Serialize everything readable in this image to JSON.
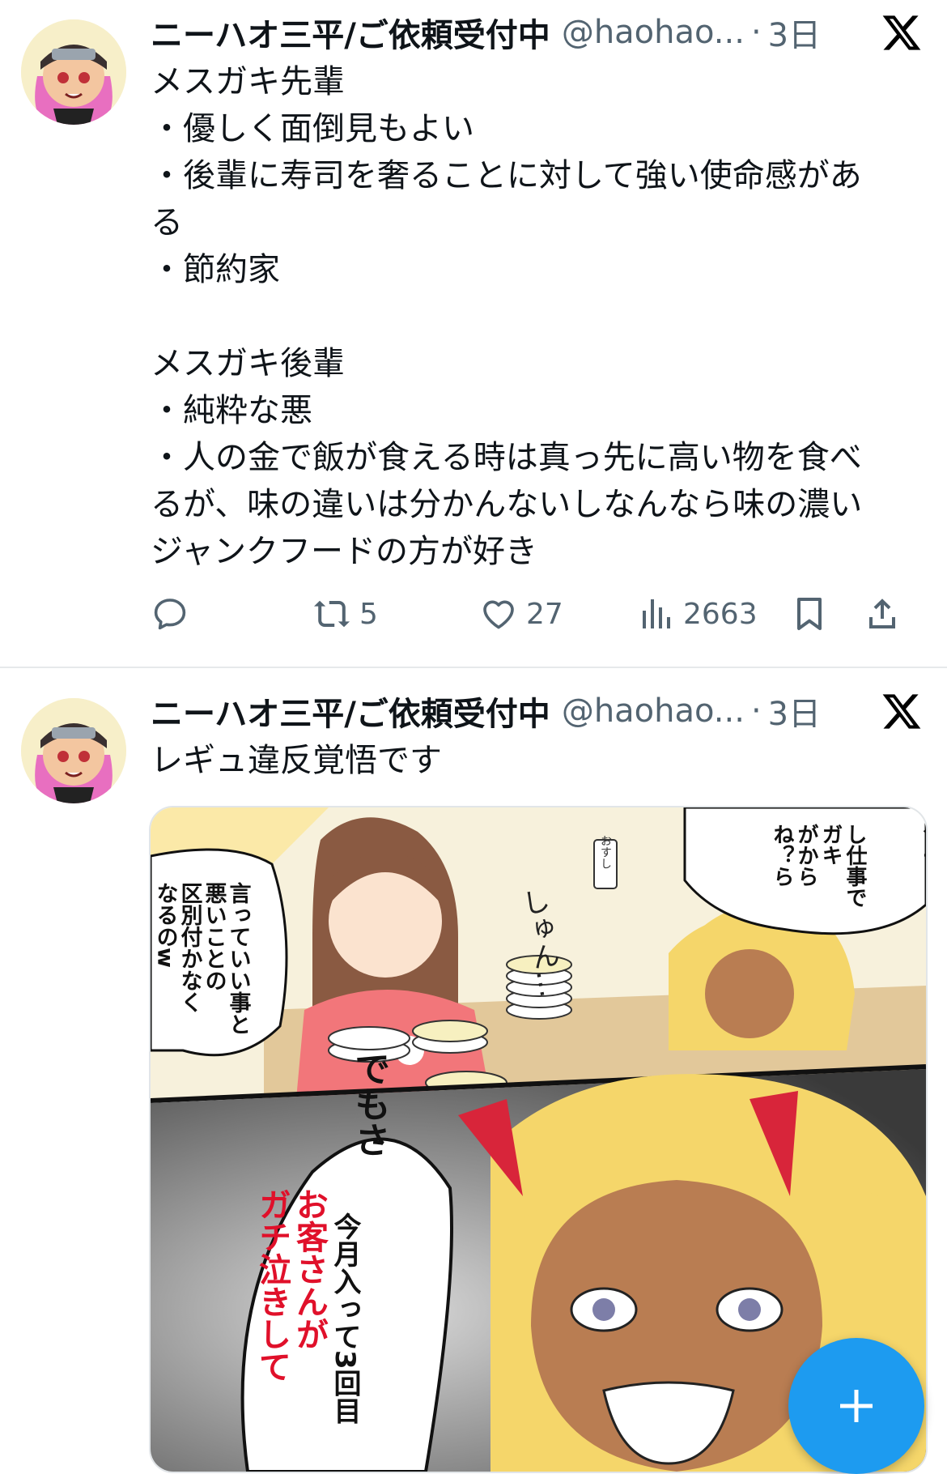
{
  "tweets": [
    {
      "author_name": "ニーハオ三平/ご依頼受付中",
      "handle": "@haohao...",
      "separator": "·",
      "time": "3日",
      "text_lines": [
        "メスガキ先輩",
        "・優しく面倒見もよい",
        "・後輩に寿司を奢ることに対して強い使命感があ",
        "る",
        "・節約家",
        "",
        "メスガキ後輩",
        "・純粋な悪",
        "・人の金で飯が食える時は真っ先に高い物を食べ",
        "るが、味の違いは分かんないしなんなら味の濃い",
        "ジャンクフードの方が好き"
      ],
      "actions": {
        "reply_icon": "reply-icon",
        "retweet_icon": "retweet-icon",
        "retweet_count": "5",
        "like_icon": "heart-icon",
        "like_count": "27",
        "views_icon": "views-bar-chart-icon",
        "views_count": "2663",
        "bookmark_icon": "bookmark-icon",
        "share_icon": "share-icon"
      }
    },
    {
      "author_name": "ニーハオ三平/ご依頼受付中",
      "handle": "@haohao...",
      "separator": "·",
      "time": "3日",
      "text_lines": [
        "レギュ違反覚悟です"
      ],
      "media": {
        "type": "manga-image",
        "bubbles": {
          "top_right": [
            "るよ？",
            "し仕事で",
            "ガキ",
            "がから",
            "ね？ら"
          ],
          "left": [
            "言っていい事と",
            "悪いことの",
            "区別付かなく",
            "なるのw"
          ],
          "sfx_shun": "しゅん…",
          "sushi_label": "おすし",
          "center": "でもさ",
          "bottom_black": "今月入って3回目",
          "bottom_red": [
            "お客さんが",
            "ガチ泣きして"
          ]
        }
      }
    }
  ],
  "fab": {
    "icon": "compose-plus-icon"
  },
  "colors": {
    "accent": "#1d9bf0",
    "text": "#0f1419",
    "muted": "#536471",
    "divider": "#e6e9eb",
    "manga_red": "#e0102a"
  }
}
